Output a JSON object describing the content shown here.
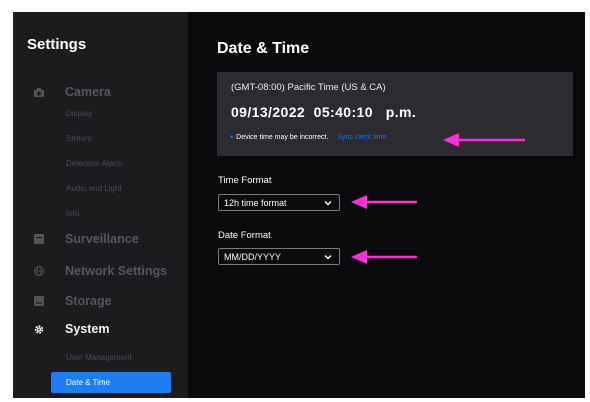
{
  "sidebar": {
    "title": "Settings",
    "groups": [
      {
        "label": "Camera",
        "icon": "camera-icon"
      },
      {
        "label": "Surveillance",
        "icon": "surveillance-icon"
      },
      {
        "label": "Network Settings",
        "icon": "globe-icon"
      },
      {
        "label": "Storage",
        "icon": "storage-icon"
      },
      {
        "label": "System",
        "icon": "gear-icon"
      }
    ],
    "camera_items": [
      "Display",
      "Stream",
      "Detection Alarm",
      "Audio and Light",
      "Info"
    ],
    "system_items": [
      "User Management",
      "Date & Time"
    ]
  },
  "main": {
    "title": "Date & Time",
    "timezone": "(GMT-08:00) Pacific Time (US & CA)",
    "datetime": "09/13/2022  05:40:10   p.m.",
    "warning": "Device time may be incorrect.",
    "sync_link": "Sync client time",
    "time_format": {
      "label": "Time Format",
      "value": "12h time format"
    },
    "date_format": {
      "label": "Date Format",
      "value": "MM/DD/YYYY"
    }
  },
  "colors": {
    "accent": "#1d7df2",
    "annotation_arrow": "#ff2fd6",
    "sidebar_bg": "#1c1c1f",
    "card_bg": "#2c2c30",
    "app_bg": "#0a0a0c"
  }
}
